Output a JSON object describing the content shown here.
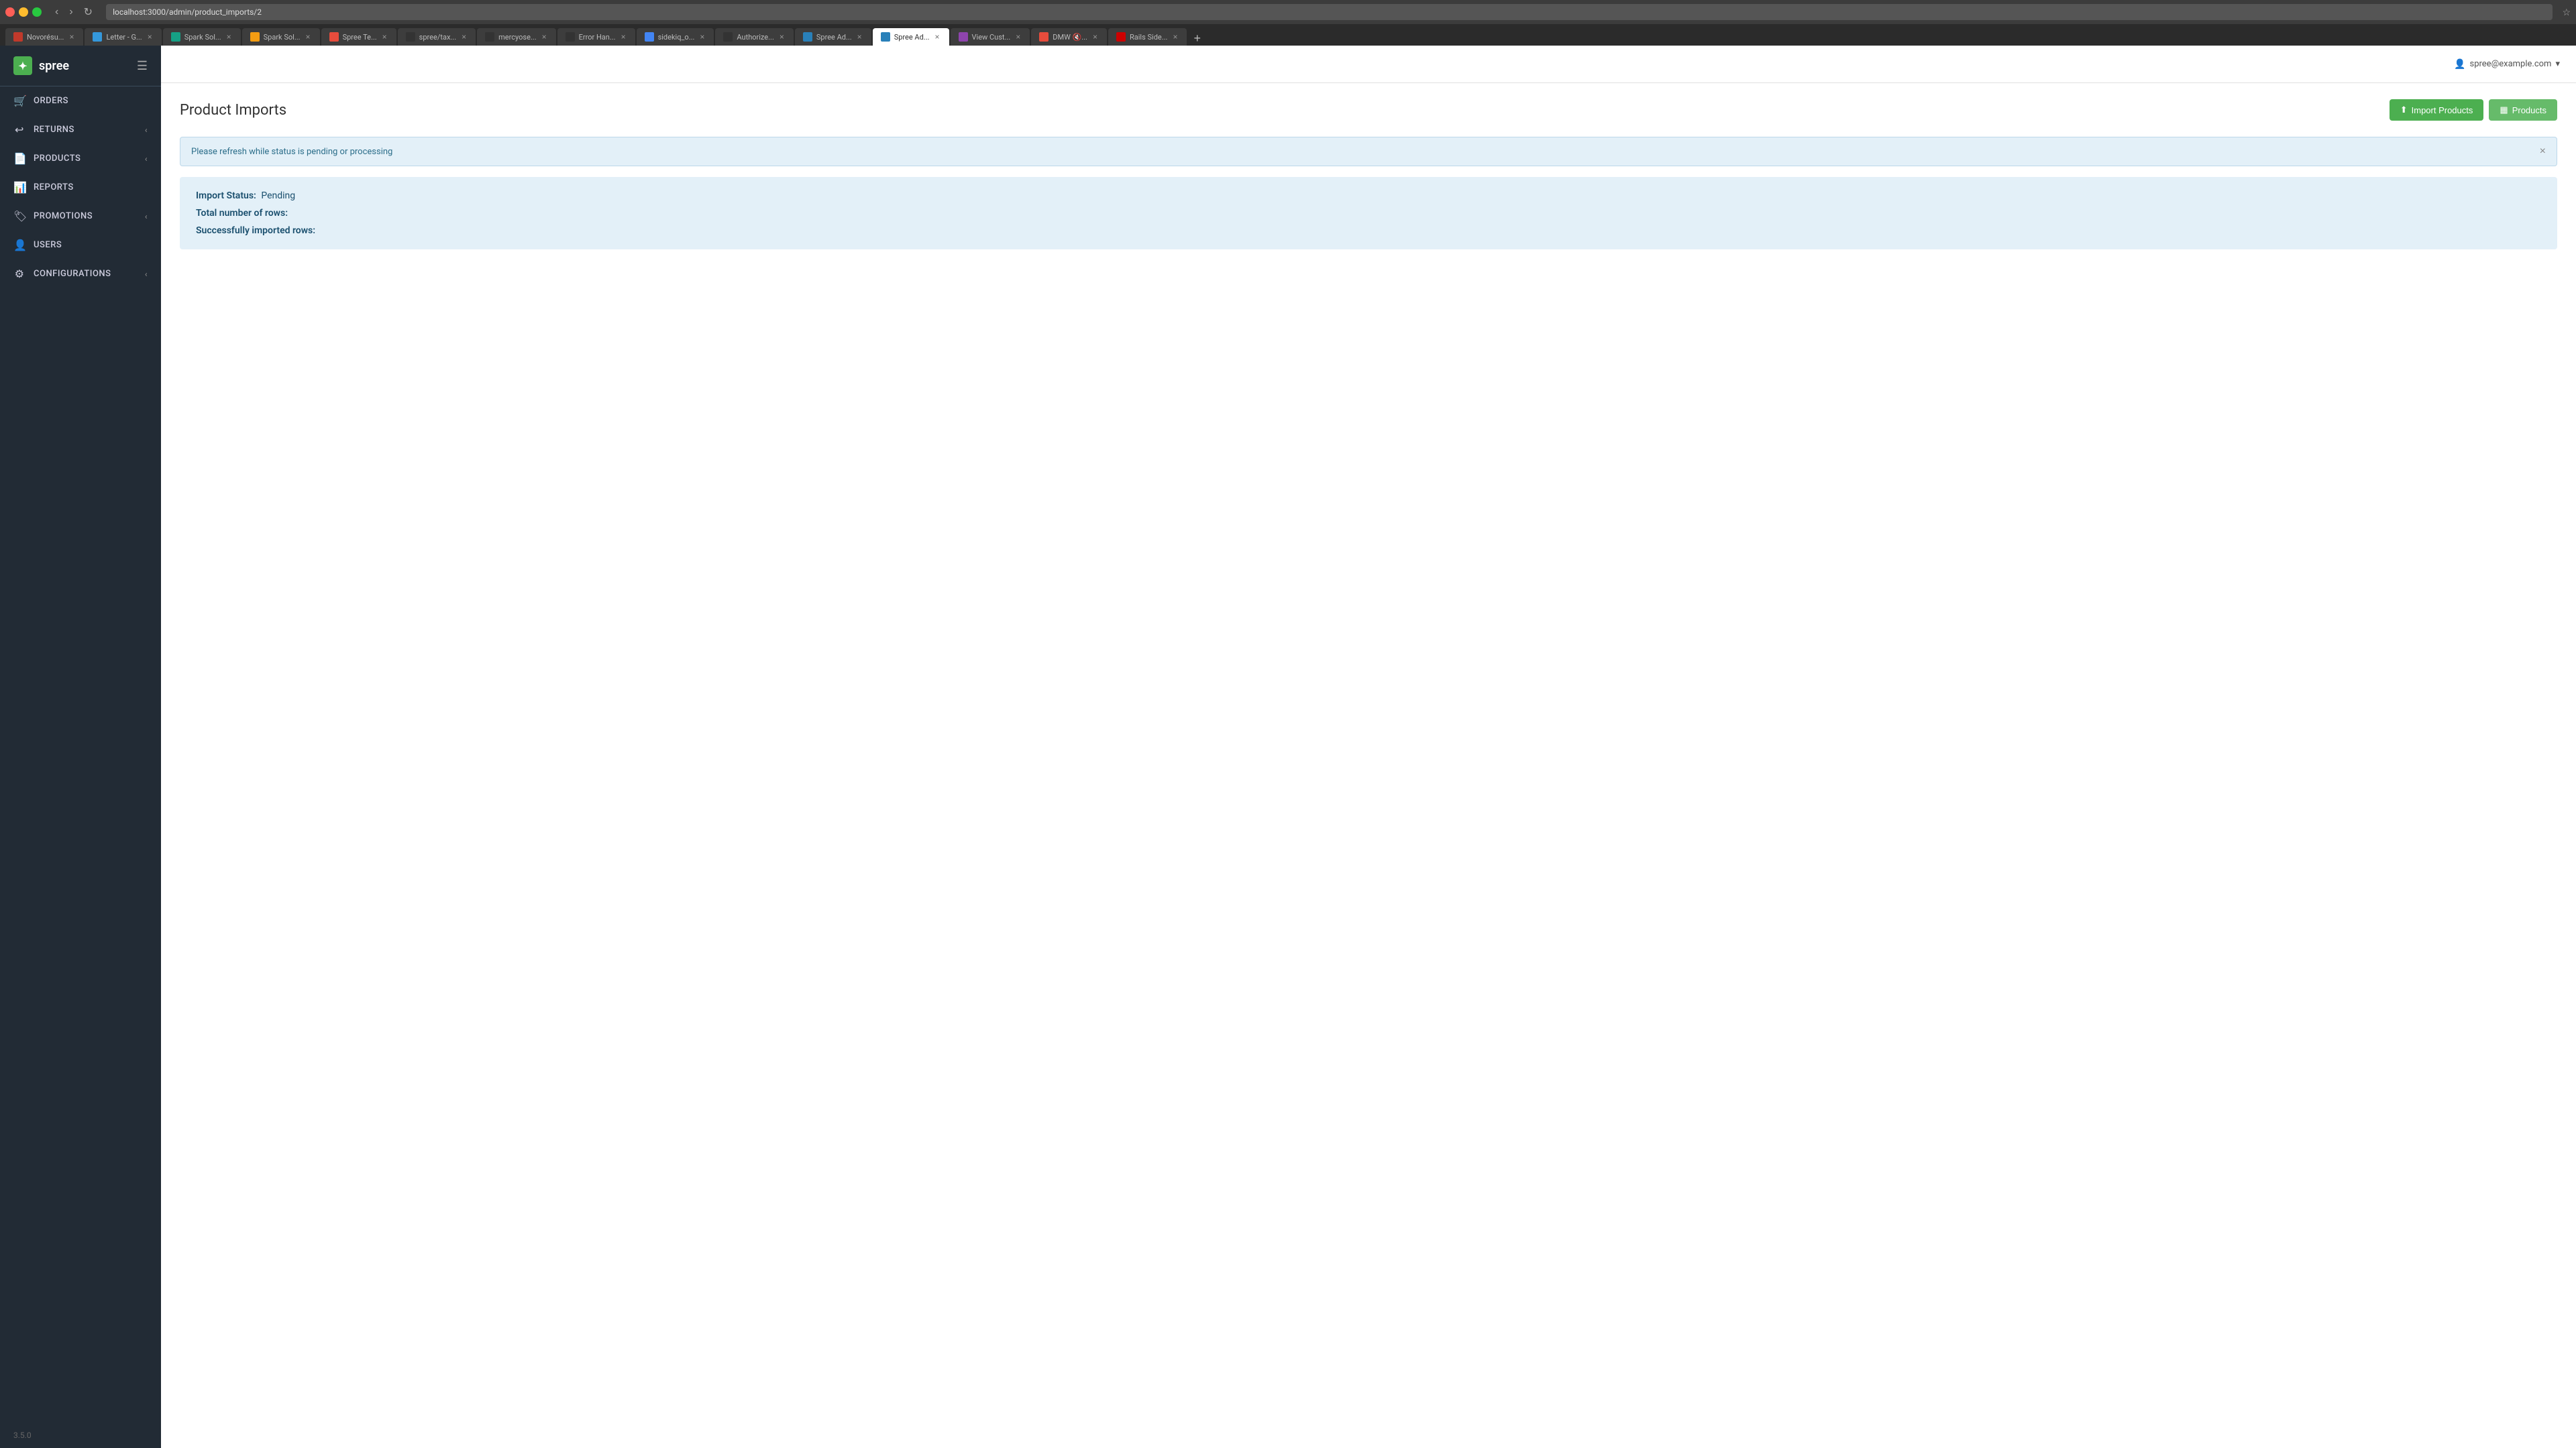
{
  "browser": {
    "url": "localhost:3000/admin/product_imports/2",
    "tabs": [
      {
        "id": "novoref",
        "label": "Novorésu...",
        "favicon_class": "fav-novoref",
        "active": false
      },
      {
        "id": "letter",
        "label": "Letter - G...",
        "favicon_class": "fav-letter",
        "active": false
      },
      {
        "id": "spark1",
        "label": "Spark Sol...",
        "favicon_class": "fav-spark1",
        "active": false
      },
      {
        "id": "spark2",
        "label": "Spark Sol...",
        "favicon_class": "fav-spark2",
        "active": false
      },
      {
        "id": "spree-t",
        "label": "Spree Te...",
        "favicon_class": "fav-spree-t",
        "active": false
      },
      {
        "id": "github1",
        "label": "spree/tax...",
        "favicon_class": "fav-github",
        "active": false
      },
      {
        "id": "github2",
        "label": "mercyose...",
        "favicon_class": "fav-github",
        "active": false
      },
      {
        "id": "errhand",
        "label": "Error Han...",
        "favicon_class": "fav-github",
        "active": false
      },
      {
        "id": "sidekiq",
        "label": "sidekiq_o...",
        "favicon_class": "fav-google",
        "active": false
      },
      {
        "id": "github3",
        "label": "Authorize...",
        "favicon_class": "fav-github",
        "active": false
      },
      {
        "id": "spree-a1",
        "label": "Spree Ad...",
        "favicon_class": "fav-spree-a",
        "active": false
      },
      {
        "id": "spree-a2",
        "label": "Spree Ad...",
        "favicon_class": "fav-spree-active",
        "active": true
      },
      {
        "id": "view",
        "label": "View Cust...",
        "favicon_class": "fav-view",
        "active": false
      },
      {
        "id": "youtube",
        "label": "DMW 🔇...",
        "favicon_class": "fav-youtube",
        "active": false
      },
      {
        "id": "rails",
        "label": "Rails Side...",
        "favicon_class": "fav-rails",
        "active": false
      }
    ]
  },
  "app": {
    "logo_text": "spree",
    "user_email": "spree@example.com"
  },
  "sidebar": {
    "items": [
      {
        "id": "orders",
        "label": "ORDERS",
        "icon": "🛒",
        "has_chevron": false
      },
      {
        "id": "returns",
        "label": "RETURNS",
        "icon": "↩",
        "has_chevron": true
      },
      {
        "id": "products",
        "label": "PRODUCTS",
        "icon": "📄",
        "has_chevron": true
      },
      {
        "id": "reports",
        "label": "REPORTS",
        "icon": "📊",
        "has_chevron": false
      },
      {
        "id": "promotions",
        "label": "PROMOTIONS",
        "icon": "🏷",
        "has_chevron": true
      },
      {
        "id": "users",
        "label": "USERS",
        "icon": "👤",
        "has_chevron": false
      },
      {
        "id": "configurations",
        "label": "CONFIGURATIONS",
        "icon": "⚙",
        "has_chevron": true
      }
    ],
    "version": "3.5.0"
  },
  "page": {
    "title": "Product Imports",
    "alert_message": "Please refresh while status is pending or processing",
    "import_products_btn": "Import Products",
    "products_btn": "Products",
    "status": {
      "label_import_status": "Import Status:",
      "import_status_value": "Pending",
      "label_total_rows": "Total number of rows:",
      "total_rows_value": "",
      "label_success_rows": "Successfully imported rows:",
      "success_rows_value": ""
    }
  }
}
